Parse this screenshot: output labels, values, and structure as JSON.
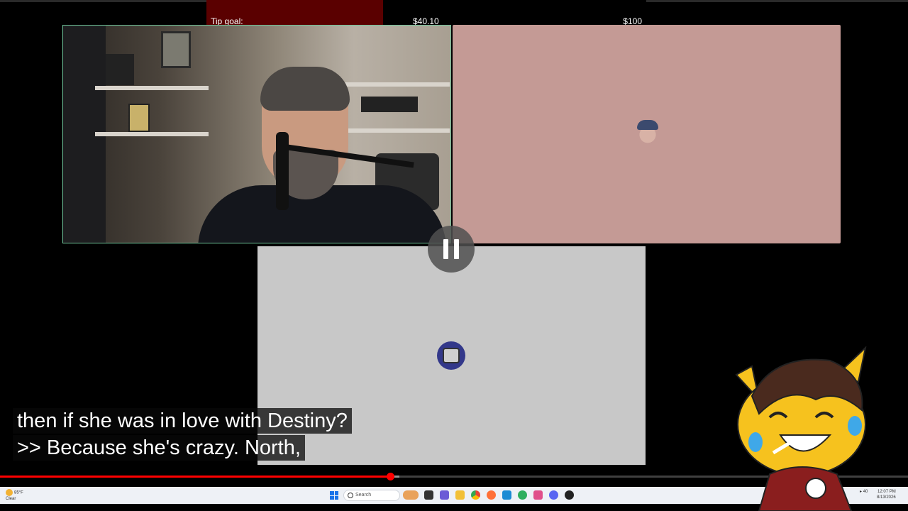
{
  "tip_goal": {
    "label": "Tip goal:",
    "current": "$40.10",
    "target": "$100",
    "progress_fraction": 0.401
  },
  "player": {
    "state": "paused",
    "progress_fraction": 0.43,
    "buffered_fraction": 0.44
  },
  "captions": {
    "line1": "then if she was in love with Destiny?",
    "line2": ">> Because she's crazy. North,"
  },
  "taskbar": {
    "weather_temp": "85°F",
    "weather_desc": "Clear",
    "search_placeholder": "Search",
    "apps": [
      "file-explorer-icon",
      "folder-icon",
      "chrome-icon",
      "firefox-icon",
      "edge-icon",
      "photos-icon",
      "discord-icon",
      "app-icon",
      "game-icon"
    ],
    "clock_time": "12:07 PM",
    "clock_date": "8/13/2026",
    "volume_label": "40"
  },
  "colors": {
    "tip_fill": "#5a0000",
    "tile_pink": "#c49a95",
    "tile_gray": "#c8c8c8",
    "progress": "#ff0000",
    "webcam_border": "#6fc59a"
  }
}
